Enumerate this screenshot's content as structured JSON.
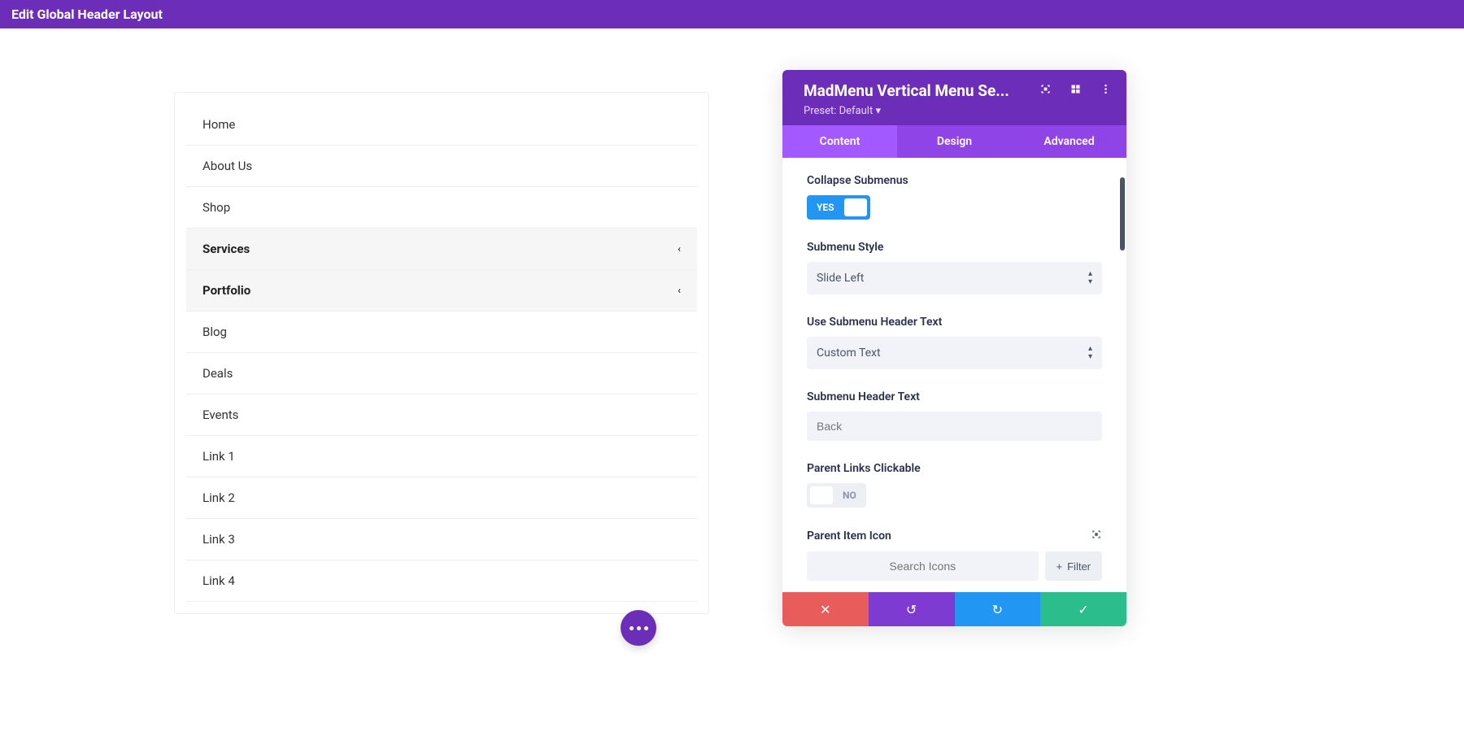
{
  "topbar": {
    "title": "Edit Global Header Layout"
  },
  "menu": {
    "items": [
      {
        "label": "Home",
        "parent": false
      },
      {
        "label": "About Us",
        "parent": false
      },
      {
        "label": "Shop",
        "parent": false
      },
      {
        "label": "Services",
        "parent": true
      },
      {
        "label": "Portfolio",
        "parent": true
      },
      {
        "label": "Blog",
        "parent": false
      },
      {
        "label": "Deals",
        "parent": false
      },
      {
        "label": "Events",
        "parent": false
      },
      {
        "label": "Link 1",
        "parent": false
      },
      {
        "label": "Link 2",
        "parent": false
      },
      {
        "label": "Link 3",
        "parent": false
      },
      {
        "label": "Link 4",
        "parent": false
      }
    ]
  },
  "panel": {
    "title": "MadMenu Vertical Menu Se...",
    "preset": "Preset: Default",
    "tabs": {
      "content": "Content",
      "design": "Design",
      "advanced": "Advanced"
    },
    "fields": {
      "collapse_label": "Collapse Submenus",
      "collapse_toggle": "YES",
      "submenu_style_label": "Submenu Style",
      "submenu_style_value": "Slide Left",
      "use_header_text_label": "Use Submenu Header Text",
      "use_header_text_value": "Custom Text",
      "header_text_label": "Submenu Header Text",
      "header_text_placeholder": "Back",
      "parent_links_label": "Parent Links Clickable",
      "parent_links_toggle": "NO",
      "parent_icon_label": "Parent Item Icon",
      "icon_search_placeholder": "Search Icons",
      "filter_label": "Filter"
    }
  }
}
